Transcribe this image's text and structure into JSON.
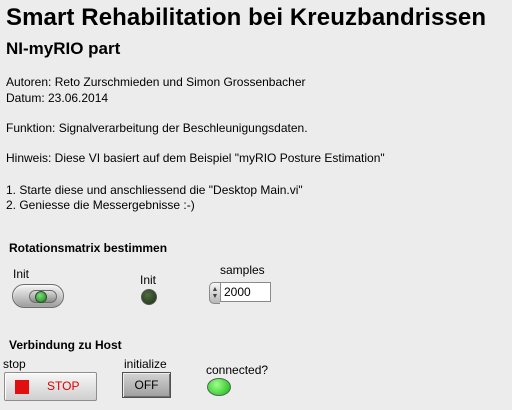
{
  "header": {
    "title": "Smart Rehabilitation bei Kreuzbandrissen",
    "subtitle": "NI-myRIO part"
  },
  "info": {
    "authors": "Autoren: Reto Zurschmieden und Simon Grossenbacher",
    "date": "Datum: 23.06.2014",
    "function": "Funktion: Signalverarbeitung der Beschleunigungsdaten.",
    "hint": "Hinweis: Diese VI basiert auf dem Beispiel \"myRIO Posture Estimation\"",
    "step1": "1. Starte diese und anschliessend die \"Desktop Main.vi\"",
    "step2": "2. Geniesse die Messergebnisse :-)"
  },
  "rotation": {
    "section_label": "Rotationsmatrix bestimmen",
    "init_switch_label": "Init",
    "init_led_label": "Init",
    "samples_label": "samples",
    "samples_value": "2000"
  },
  "host": {
    "section_label": "Verbindung zu Host",
    "stop_label": "stop",
    "stop_button_text": "STOP",
    "initialize_label": "initialize",
    "initialize_button_text": "OFF",
    "connected_label": "connected?"
  },
  "icons": {
    "stop": "stop-square-icon",
    "spinner": "increment-decrement-icon"
  },
  "colors": {
    "background": "#ececec",
    "stop_red": "#e01010",
    "led_on": "#12b512",
    "led_off": "#1c2e16"
  }
}
